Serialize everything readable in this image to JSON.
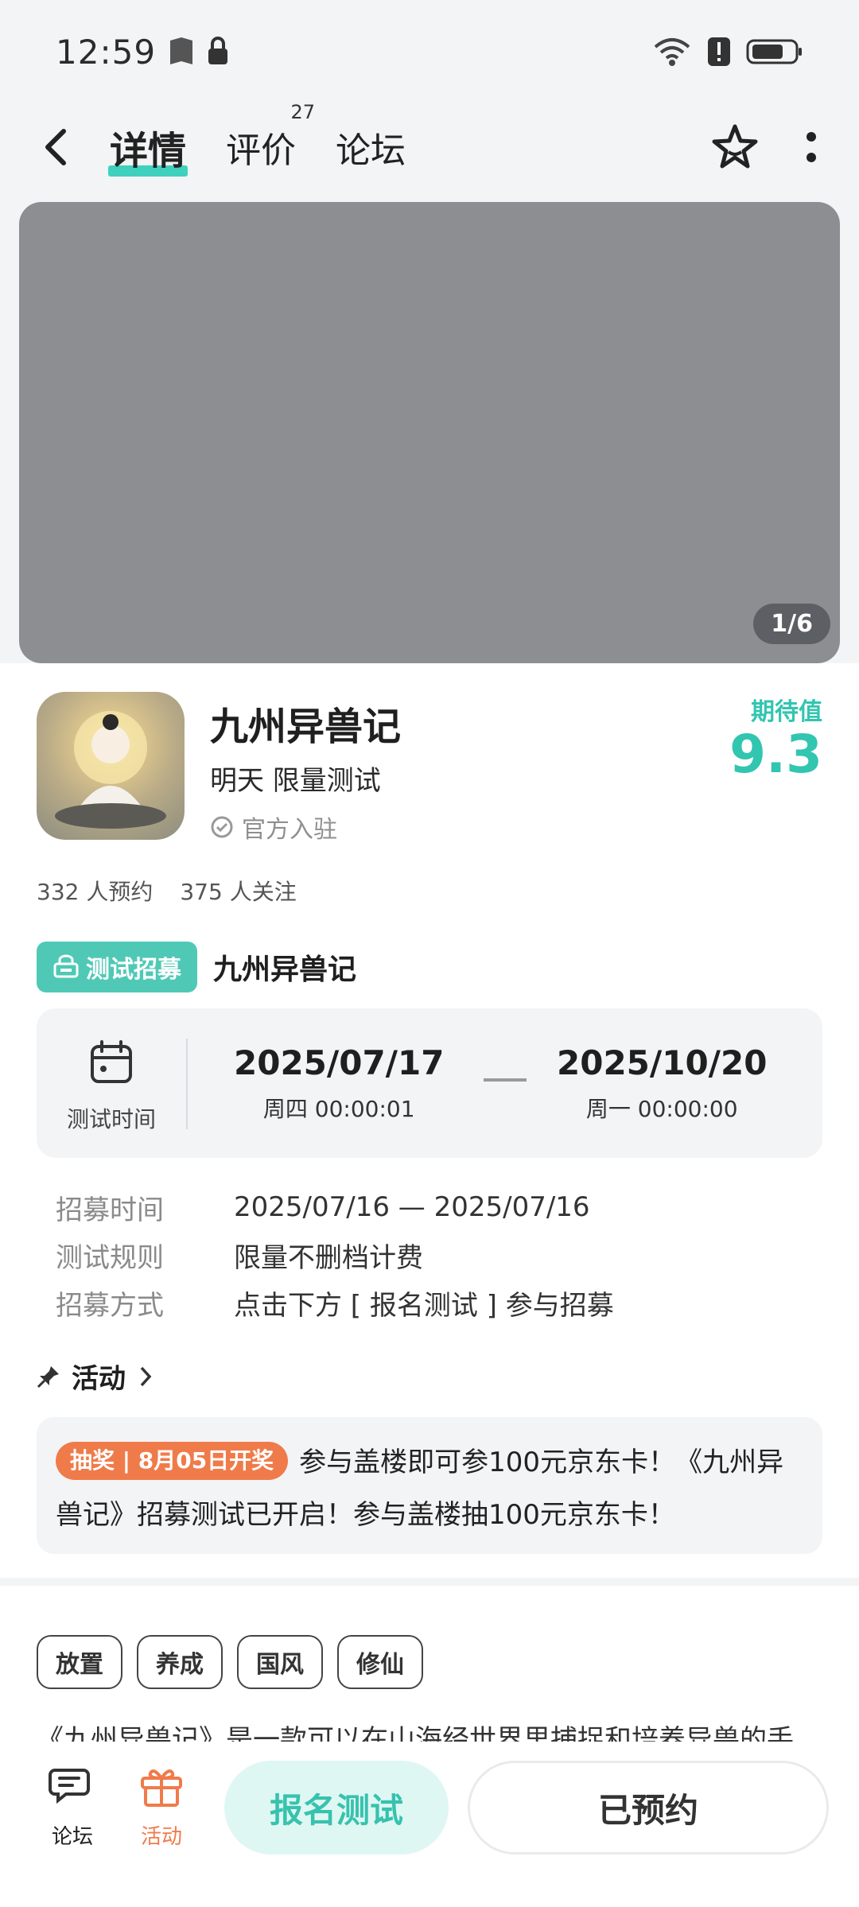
{
  "status_bar": {
    "time": "12:59"
  },
  "nav": {
    "tabs": [
      {
        "label": "详情"
      },
      {
        "label": "评价",
        "count": "27"
      },
      {
        "label": "论坛"
      }
    ]
  },
  "media": {
    "counter": "1/6"
  },
  "app": {
    "title": "九州异兽记",
    "subtitle": "明天 限量测试",
    "official": "官方入驻",
    "expect_label": "期待值",
    "expect_value": "9.3"
  },
  "stats": {
    "reservations": "332 人预约",
    "followers": "375 人关注"
  },
  "recruit": {
    "badge": "测试招募",
    "name": "九州异兽记",
    "time_label": "测试时间",
    "start_date": "2025/07/17",
    "start_time": "周四  00:00:01",
    "end_date": "2025/10/20",
    "end_time": "周一  00:00:00",
    "rows": [
      {
        "key": "招募时间",
        "value": "2025/07/16 — 2025/07/16"
      },
      {
        "key": "测试规则",
        "value": "限量不删档计费"
      },
      {
        "key": "招募方式",
        "value": "点击下方 [ 报名测试 ] 参与招募"
      }
    ]
  },
  "activity": {
    "title": "活动",
    "tag": "抽奖 | 8月05日开奖",
    "text": "参与盖楼即可参100元京东卡！《九州异兽记》招募测试已开启！参与盖楼抽100元京东卡！"
  },
  "tags": [
    "放置",
    "养成",
    "国风",
    "修仙"
  ],
  "description": "《九州异兽记》是一款可以在山海经世界里捕捉和培养异兽的手",
  "bottom_bar": {
    "forum_label": "论坛",
    "activity_label": "活动",
    "signup": "报名测试",
    "reserved": "已预约"
  },
  "colors": {
    "accent": "#3fd1bd",
    "orange": "#f07b4a"
  }
}
